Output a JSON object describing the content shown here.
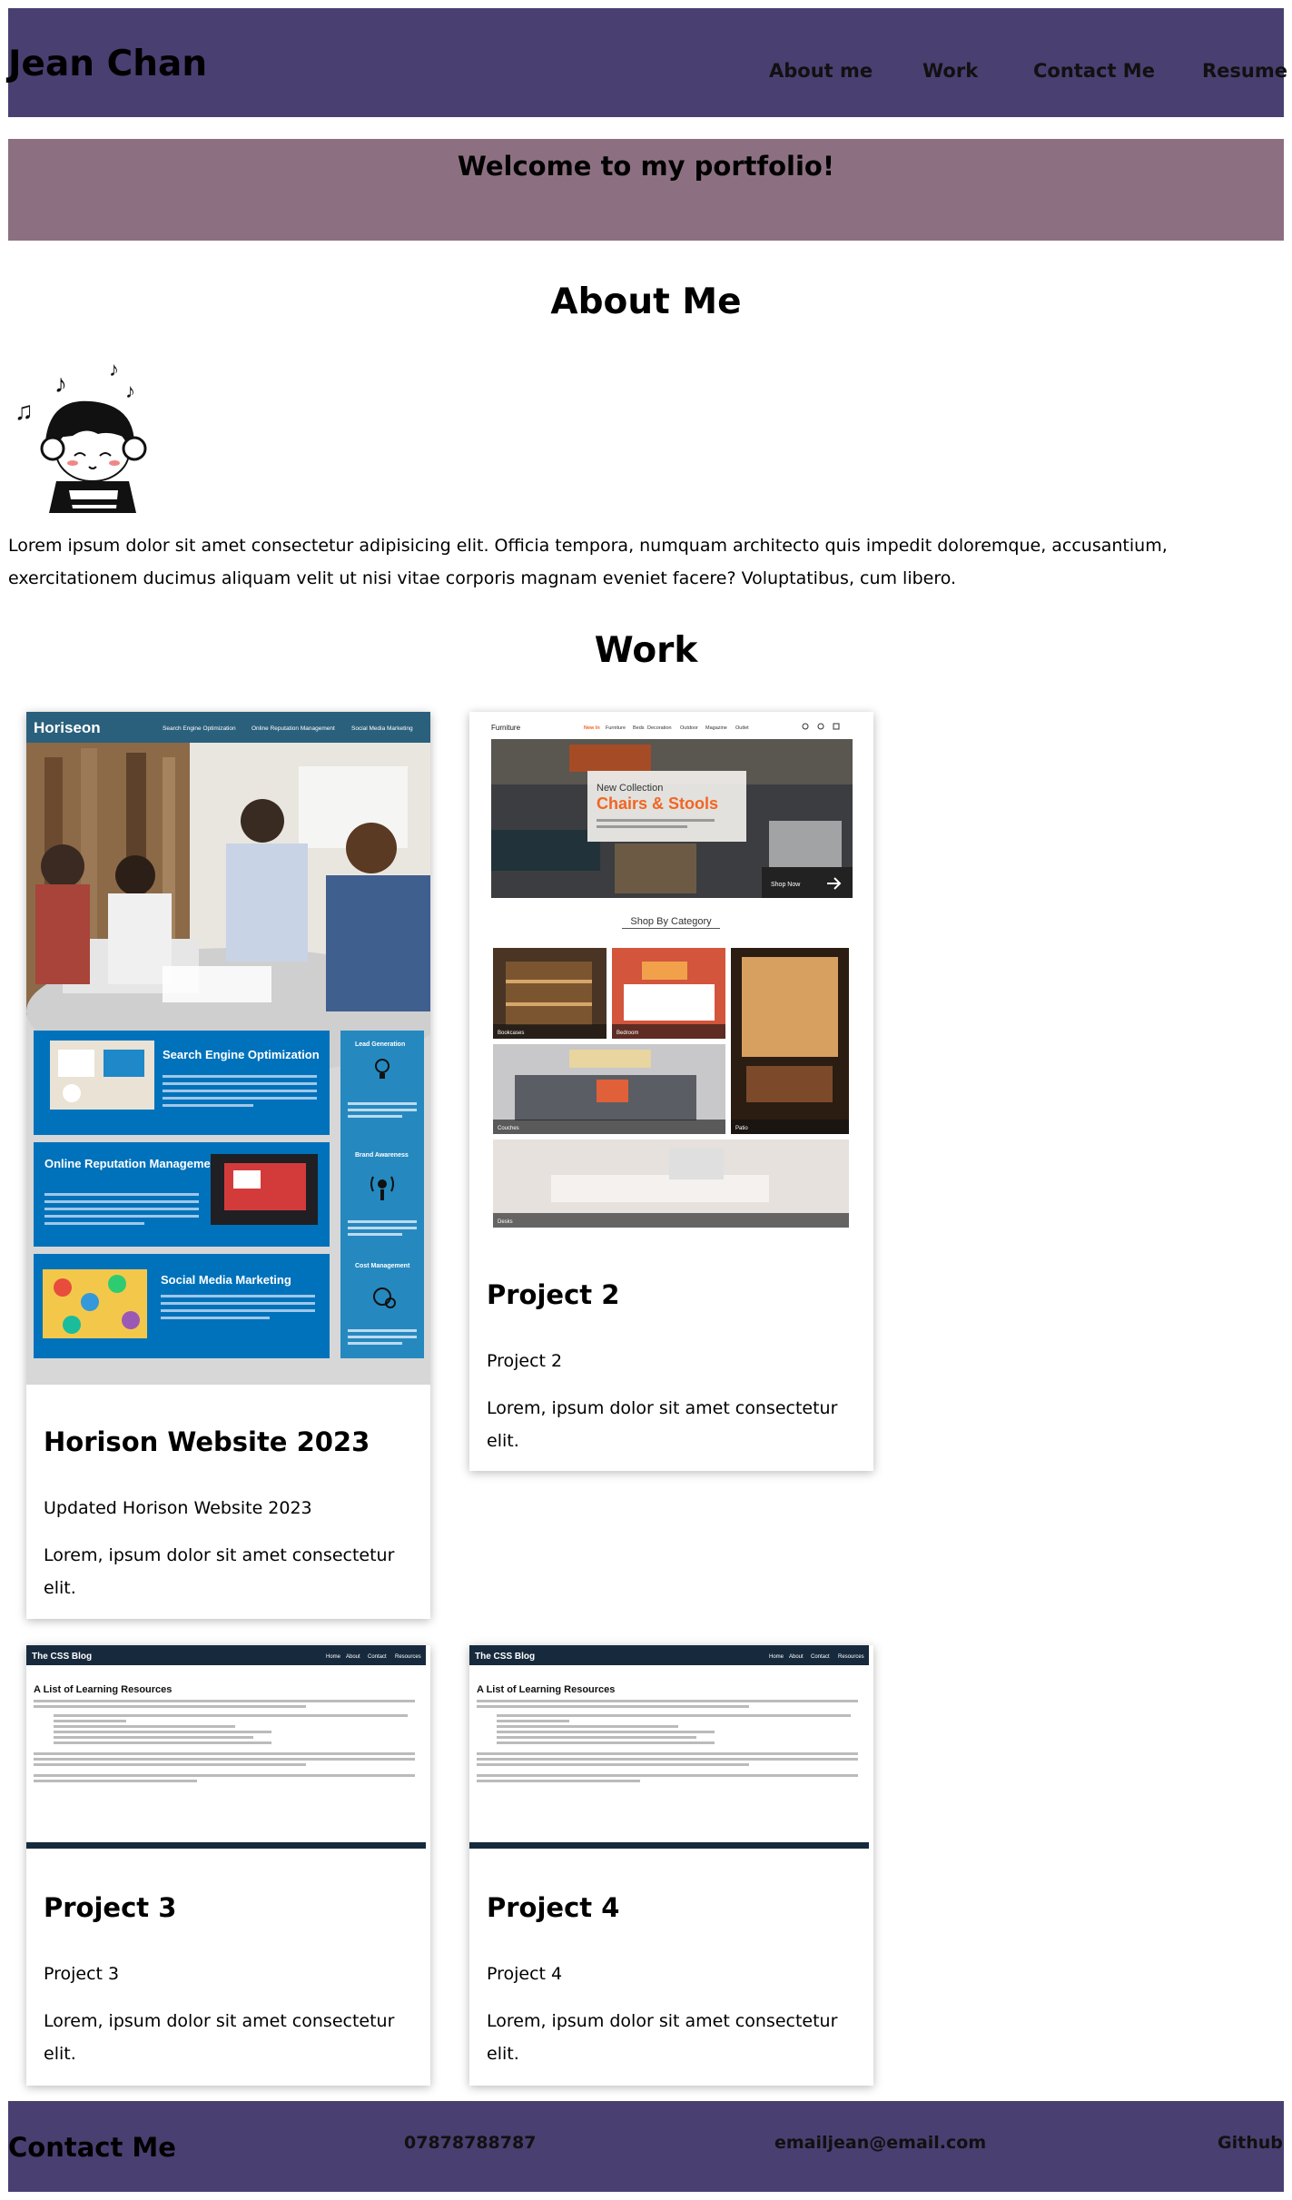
{
  "header": {
    "brand": "Jean Chan",
    "nav": [
      {
        "label": "About me"
      },
      {
        "label": "Work"
      },
      {
        "label": "Contact Me"
      },
      {
        "label": "Resume"
      }
    ]
  },
  "welcome": {
    "text": "Welcome to my portfolio!"
  },
  "about": {
    "title": "About Me",
    "text": "Lorem ipsum dolor sit amet consectetur adipisicing elit. Officia tempora, numquam architecto quis impedit doloremque, accusantium, exercitationem ducimus aliquam velit ut nisi vitae corporis magnam eveniet facere? Voluptatibus, cum libero."
  },
  "work": {
    "title": "Work",
    "projects": [
      {
        "title": "Horison Website 2023",
        "subtitle": "Updated Horison Website 2023",
        "description": "Lorem, ipsum dolor sit amet consectetur elit.",
        "preview": {
          "logo": "Horiseon",
          "nav": [
            "Search Engine Optimization",
            "Online Reputation Management",
            "Social Media Marketing"
          ],
          "sections": [
            "Search Engine Optimization",
            "Online Reputation Management",
            "Social Media Marketing"
          ],
          "side": [
            "Lead Generation",
            "Brand Awareness",
            "Cost Management"
          ]
        }
      },
      {
        "title": "Project 2",
        "subtitle": "Project 2",
        "description": "Lorem, ipsum dolor sit amet consectetur elit.",
        "preview": {
          "brand": "Furniture",
          "nav": [
            "New In",
            "Furniture",
            "Beds",
            "Decoration",
            "Outdoor",
            "Magazine",
            "Outlet"
          ],
          "hero_kicker": "New Collection",
          "hero_title": "Chairs & Stools",
          "hero_button": "Shop Now",
          "category_heading": "Shop By Category",
          "categories": [
            "Bookcases",
            "Bedroom",
            "Couches",
            "Patio",
            "Desks"
          ]
        }
      },
      {
        "title": "Project 3",
        "subtitle": "Project 3",
        "description": "Lorem, ipsum dolor sit amet consectetur elit.",
        "preview": {
          "blog_title": "The CSS Blog",
          "nav": [
            "Home",
            "About",
            "Contact",
            "Resources"
          ],
          "heading": "A List of Learning Resources"
        }
      },
      {
        "title": "Project 4",
        "subtitle": "Project 4",
        "description": "Lorem, ipsum dolor sit amet consectetur elit.",
        "preview": {
          "blog_title": "The CSS Blog",
          "nav": [
            "Home",
            "About",
            "Contact",
            "Resources"
          ],
          "heading": "A List of Learning Resources"
        }
      }
    ]
  },
  "footer": {
    "title": "Contact Me",
    "phone": "07878788787",
    "email": "emailjean@email.com",
    "github": "Github"
  },
  "colors": {
    "header_bg": "#4a3f71",
    "welcome_bg": "#8c7081",
    "horiseon_blue": "#0072bb",
    "furniture_accent": "#f26522",
    "blog_navy": "#172a3d"
  },
  "icons": {
    "avatar": "headphone-girl-avatar",
    "lead": "lightbulb-icon",
    "brand": "broadcast-icon",
    "cost": "money-gears-icon"
  }
}
